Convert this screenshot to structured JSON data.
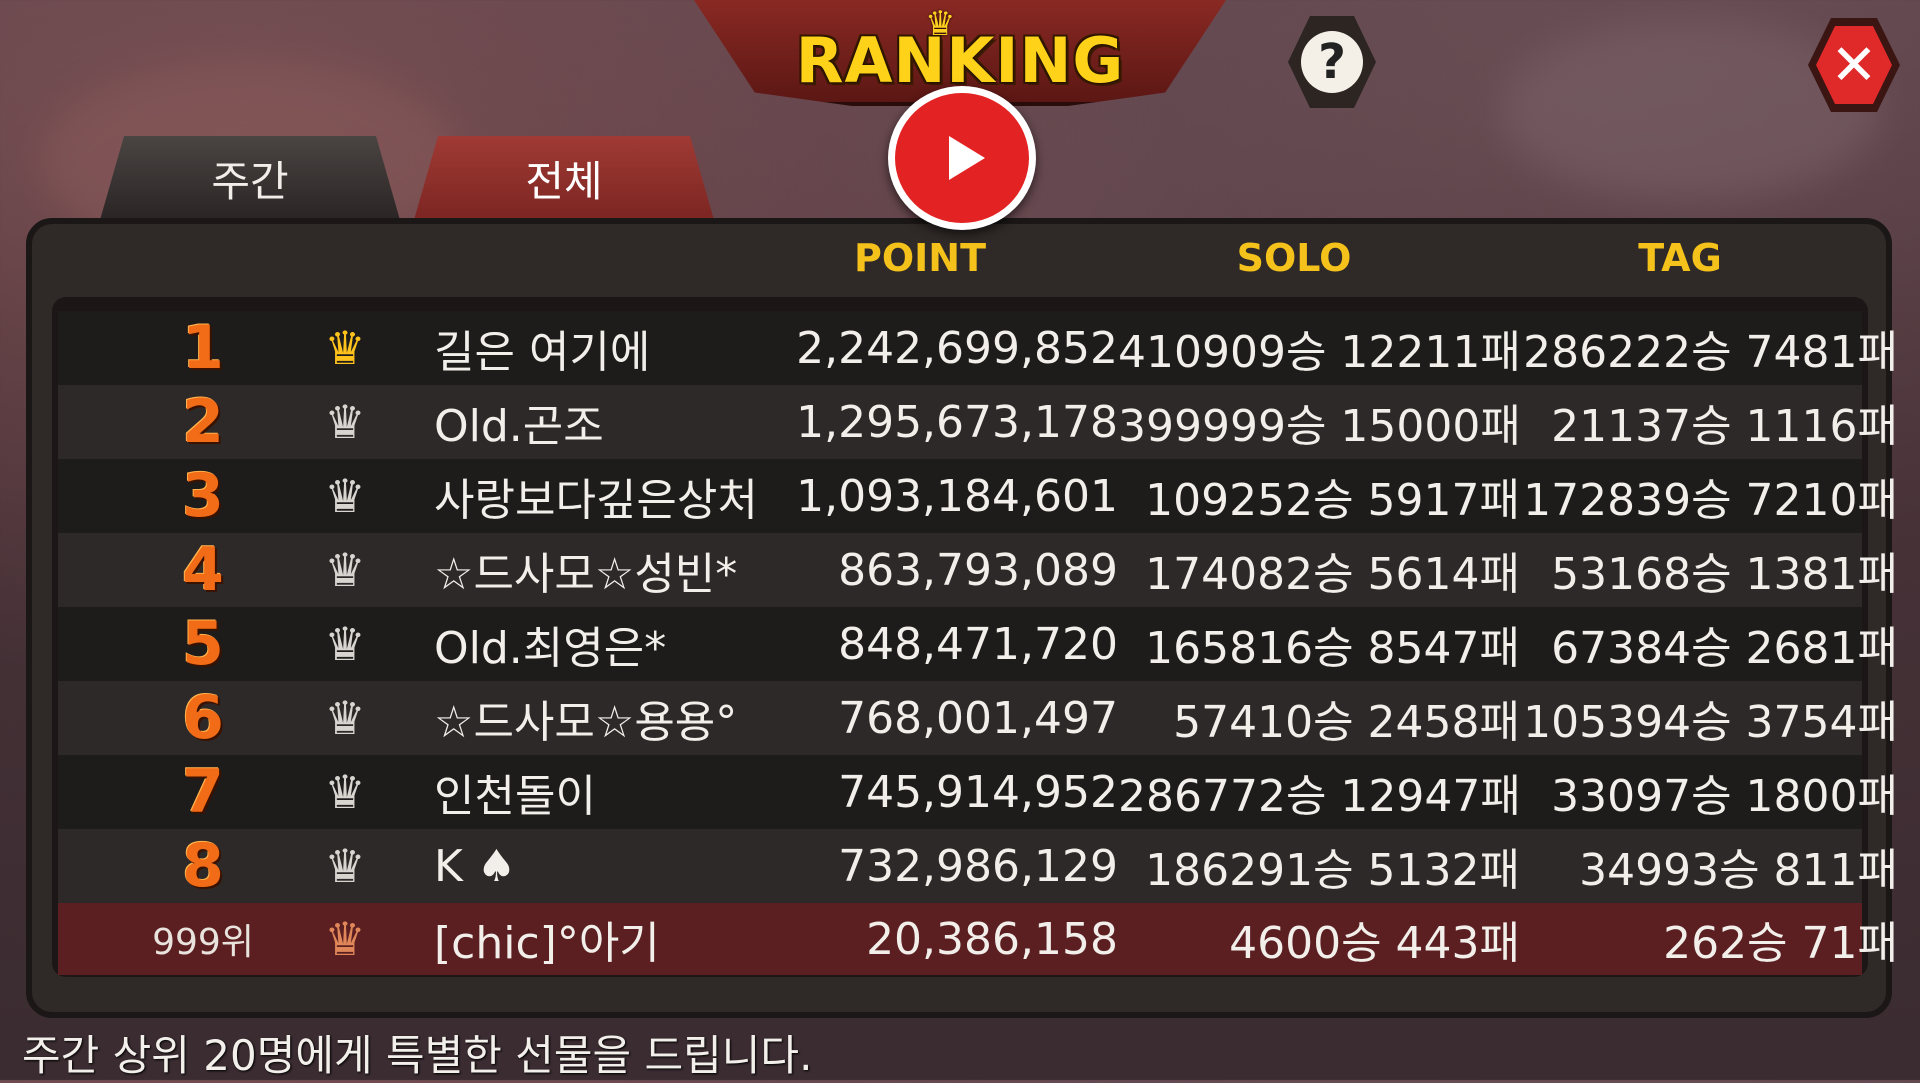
{
  "header": {
    "title": "RANKING"
  },
  "tabs": [
    {
      "label": "주간",
      "active": true
    },
    {
      "label": "전체",
      "active": false
    }
  ],
  "columns": {
    "point": "POINT",
    "solo": "SOLO",
    "tag": "TAG"
  },
  "rows": [
    {
      "rank": "1",
      "crown": "gold",
      "name": "길은 여기에",
      "point": "2,242,699,852",
      "solo": "410909승 12211패",
      "tag": "286222승 7481패"
    },
    {
      "rank": "2",
      "crown": "silver",
      "name": "Old.곤조",
      "point": "1,295,673,178",
      "solo": "399999승 15000패",
      "tag": "21137승 1116패"
    },
    {
      "rank": "3",
      "crown": "silver",
      "name": "사랑보다깊은상처",
      "point": "1,093,184,601",
      "solo": "109252승 5917패",
      "tag": "172839승 7210패"
    },
    {
      "rank": "4",
      "crown": "silver",
      "name": "☆드사모☆성빈*",
      "point": "863,793,089",
      "solo": "174082승 5614패",
      "tag": "53168승 1381패"
    },
    {
      "rank": "5",
      "crown": "silver",
      "name": "Old.최영은*",
      "point": "848,471,720",
      "solo": "165816승 8547패",
      "tag": "67384승 2681패"
    },
    {
      "rank": "6",
      "crown": "silver",
      "name": "☆드사모☆용용°",
      "point": "768,001,497",
      "solo": "57410승 2458패",
      "tag": "105394승 3754패"
    },
    {
      "rank": "7",
      "crown": "silver",
      "name": "인천돌이",
      "point": "745,914,952",
      "solo": "286772승 12947패",
      "tag": "33097승 1800패"
    },
    {
      "rank": "8",
      "crown": "silver",
      "name": "K ♠",
      "point": "732,986,129",
      "solo": "186291승 5132패",
      "tag": "34993승 811패"
    }
  ],
  "my_rank": {
    "rank": "999위",
    "crown": "bronze",
    "name": "[chic]°아기",
    "point": "20,386,158",
    "solo": "4600승 443패",
    "tag": "262승 71패"
  },
  "footer": "주간 상위 20명에게 특별한 선물을 드립니다.",
  "icons": {
    "help": "help-icon",
    "close": "close-icon",
    "video": "play-video-icon",
    "crown": "crown-icon"
  },
  "colors": {
    "accent": "#ffd21a",
    "rank": "#f26b17",
    "close": "#e02a2a",
    "video": "#e32323"
  }
}
